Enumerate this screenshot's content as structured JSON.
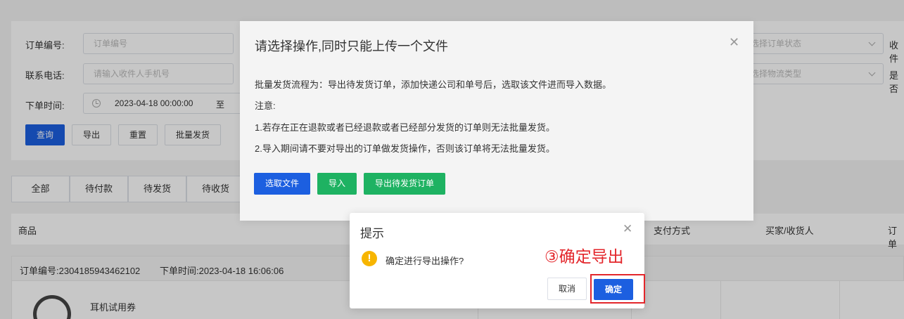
{
  "filters": {
    "order_no_label": "订单编号:",
    "order_no_placeholder": "订单编号",
    "phone_label": "联系电话:",
    "phone_placeholder": "请输入收件人手机号",
    "time_label": "下单时间:",
    "time_start": "2023-04-18 00:00:00",
    "time_to": "至",
    "status_placeholder": "选择订单状态",
    "logistics_placeholder": "选择物流类型",
    "right_label_1": "收件",
    "right_label_2": "是否"
  },
  "actions": {
    "query": "查询",
    "export": "导出",
    "reset": "重置",
    "batch_ship": "批量发货"
  },
  "tabs": [
    "全部",
    "待付款",
    "待发货",
    "待收货"
  ],
  "table": {
    "col_product": "商品",
    "col_payment": "支付方式",
    "col_buyer": "买家/收货人",
    "col_order": "订单"
  },
  "order": {
    "no_text": "订单编号:2304185943462102",
    "time_text": "下单时间:2023-04-18 16:06:06",
    "product_name": "耳机试用券"
  },
  "upload_dialog": {
    "title": "请选择操作,同时只能上传一个文件",
    "line1": "批量发货流程为：导出待发货订单，添加快递公司和单号后，选取该文件进而导入数据。",
    "line2": "注意:",
    "line3": "1.若存在正在退款或者已经退款或者已经部分发货的订单则无法批量发货。",
    "line4": "2.导入期间请不要对导出的订单做发货操作，否则该订单将无法批量发货。",
    "btn_select": "选取文件",
    "btn_import": "导入",
    "btn_export_pending": "导出待发货订单"
  },
  "confirm_dialog": {
    "title": "提示",
    "message": "确定进行导出操作?",
    "cancel": "取消",
    "ok": "确定"
  },
  "annotation": "③确定导出",
  "colors": {
    "primary": "#1c5fe0",
    "success": "#1eb262",
    "warning": "#f7b500",
    "annotation": "#e3262b"
  }
}
